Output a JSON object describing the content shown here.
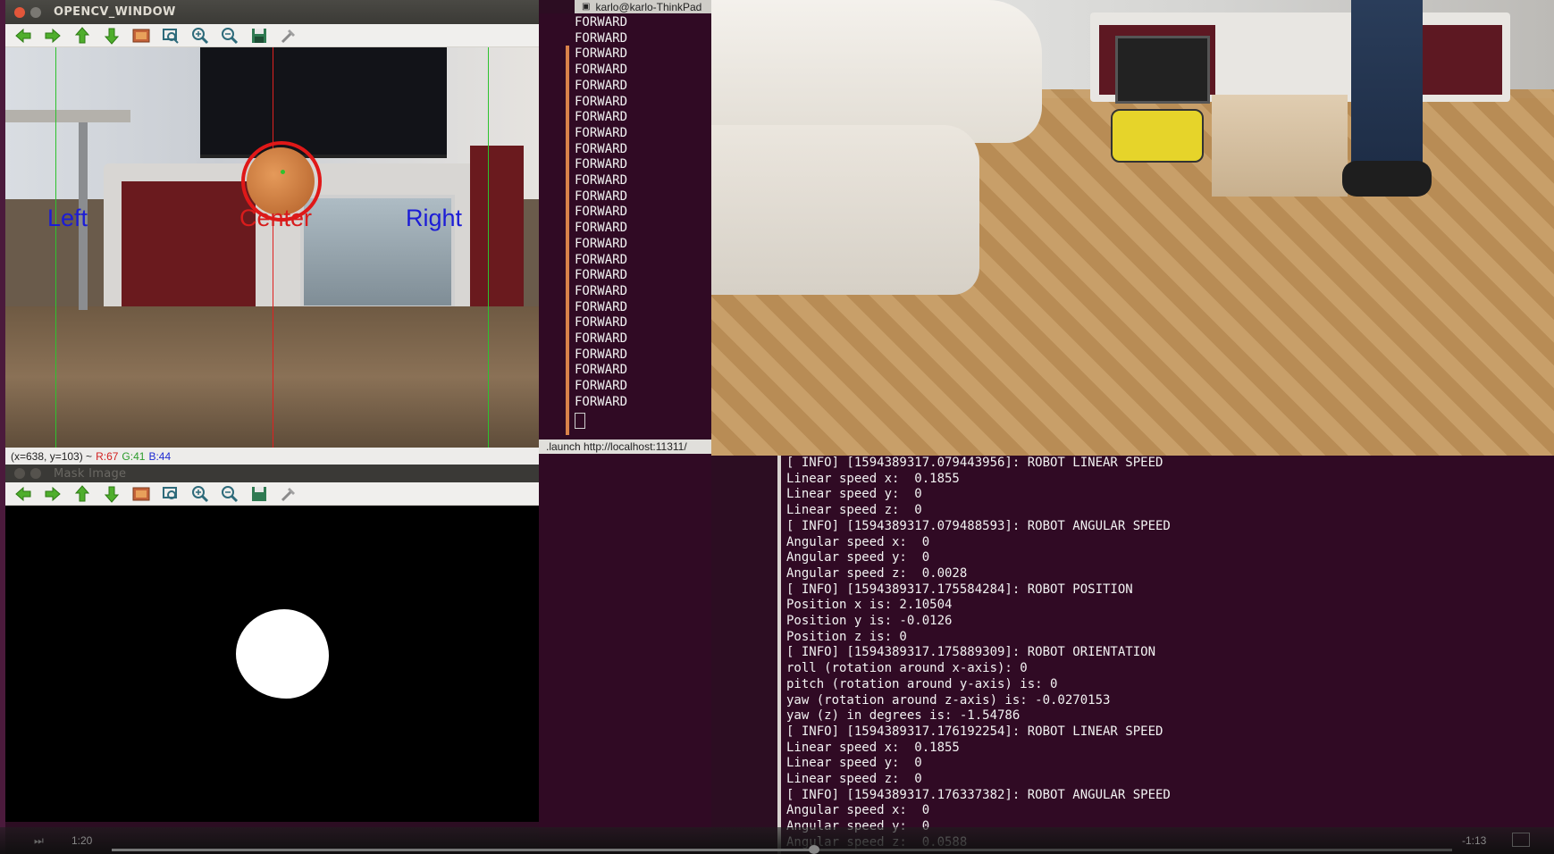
{
  "opencv_window": {
    "title": "OPENCV_WINDOW",
    "zone_labels": {
      "left": "Left",
      "center": "Center",
      "right": "Right"
    },
    "status": {
      "coords": "(x=638, y=103) ~",
      "r": "R:67",
      "g": "G:41",
      "b": "B:44"
    }
  },
  "mask_window": {
    "title": "Mask Image"
  },
  "toolbar_icons": [
    "arrow-left-icon",
    "arrow-right-icon",
    "arrow-up-icon",
    "arrow-down-icon",
    "image-icon",
    "zoom-fit-icon",
    "zoom-in-icon",
    "zoom-out-icon",
    "save-icon",
    "properties-icon"
  ],
  "terminal_forward": {
    "title": "karlo@karlo-ThinkPad",
    "lines": [
      "FORWARD",
      "FORWARD",
      "FORWARD",
      "FORWARD",
      "FORWARD",
      "FORWARD",
      "FORWARD",
      "FORWARD",
      "FORWARD",
      "FORWARD",
      "FORWARD",
      "FORWARD",
      "FORWARD",
      "FORWARD",
      "FORWARD",
      "FORWARD",
      "FORWARD",
      "FORWARD",
      "FORWARD",
      "FORWARD",
      "FORWARD",
      "FORWARD",
      "FORWARD",
      "FORWARD",
      "FORWARD"
    ]
  },
  "terminal_log": {
    "title": ".launch http://localhost:11311/",
    "lines": [
      "[ INFO] [1594389317.079443956]: ROBOT LINEAR SPEED",
      "Linear speed x:  0.1855",
      "Linear speed y:  0",
      "Linear speed z:  0",
      "[ INFO] [1594389317.079488593]: ROBOT ANGULAR SPEED",
      "Angular speed x:  0",
      "Angular speed y:  0",
      "Angular speed z:  0.0028",
      "[ INFO] [1594389317.175584284]: ROBOT POSITION",
      "Position x is: 2.10504",
      "Position y is: -0.0126",
      "Position z is: 0",
      "[ INFO] [1594389317.175889309]: ROBOT ORIENTATION",
      "roll (rotation around x-axis): 0",
      "pitch (rotation around y-axis) is: 0",
      "yaw (rotation around z-axis) is: -0.0270153",
      "yaw (z) in degrees is: -1.54786",
      "[ INFO] [1594389317.176192254]: ROBOT LINEAR SPEED",
      "Linear speed x:  0.1855",
      "Linear speed y:  0",
      "Linear speed z:  0",
      "[ INFO] [1594389317.176337382]: ROBOT ANGULAR SPEED",
      "Angular speed x:  0",
      "Angular speed y:  0",
      "Angular speed z:  0.0588"
    ]
  },
  "video_player": {
    "elapsed": "1:20",
    "remaining": "-1:13"
  },
  "colors": {
    "terminal_bg": "#300a24",
    "left_zone": "#1c1cd6",
    "center_zone": "#d81c1c",
    "right_zone": "#1c1cd6"
  }
}
